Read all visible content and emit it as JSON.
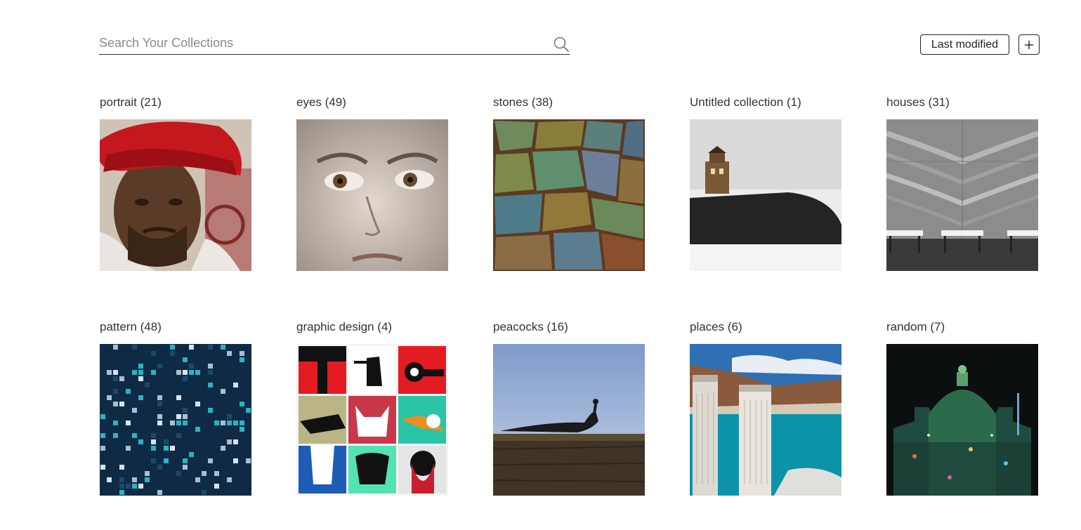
{
  "search": {
    "placeholder": "Search Your Collections",
    "icon": "search-icon"
  },
  "toolbar": {
    "sort_label": "Last modified",
    "add_icon": "plus-icon"
  },
  "collections": [
    {
      "name": "portrait",
      "count": "(21)",
      "label": "portrait (21)",
      "thumb": "man-in-red-turban"
    },
    {
      "name": "eyes",
      "count": "(49)",
      "label": "eyes (49)",
      "thumb": "child-face-closeup"
    },
    {
      "name": "stones",
      "count": "(38)",
      "label": "stones (38)",
      "thumb": "colorful-stone-wall"
    },
    {
      "name": "Untitled collection",
      "count": "(1)",
      "label": "Untitled collection (1)",
      "thumb": "lighthouse-on-rock"
    },
    {
      "name": "houses",
      "count": "(31)",
      "label": "houses (31)",
      "thumb": "marble-wall-benches"
    },
    {
      "name": "pattern",
      "count": "(48)",
      "label": "pattern (48)",
      "thumb": "blue-tile-mosaic"
    },
    {
      "name": "graphic design",
      "count": "(4)",
      "label": "graphic design (4)",
      "thumb": "poster-grid"
    },
    {
      "name": "peacocks",
      "count": "(16)",
      "label": "peacocks (16)",
      "thumb": "peacock-on-wall"
    },
    {
      "name": "places",
      "count": "(6)",
      "label": "places (6)",
      "thumb": "dam-towers-lake"
    },
    {
      "name": "random",
      "count": "(7)",
      "label": "random (7)",
      "thumb": "illuminated-cathedral"
    }
  ]
}
